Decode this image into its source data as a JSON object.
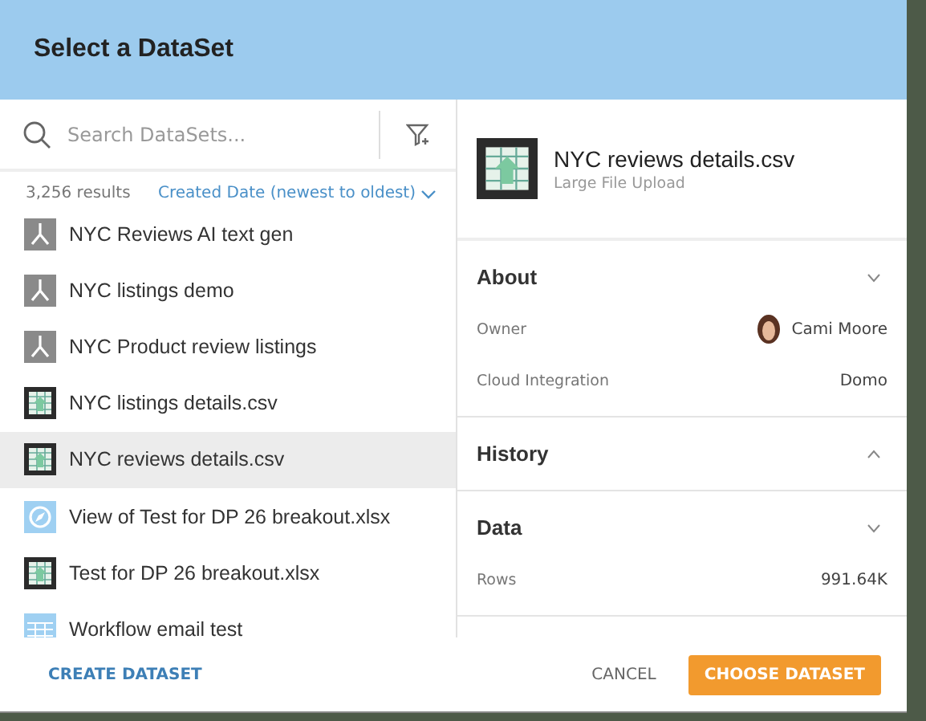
{
  "dialog": {
    "title": "Select a DataSet"
  },
  "search": {
    "placeholder": "Search DataSets..."
  },
  "results": {
    "count": "3,256 results",
    "sort": "Created Date (newest to oldest)"
  },
  "datasets": [
    {
      "name": "NYC Reviews AI text gen",
      "kind": "dataflow",
      "selected": false
    },
    {
      "name": "NYC listings demo",
      "kind": "dataflow",
      "selected": false
    },
    {
      "name": "NYC Product review listings",
      "kind": "dataflow",
      "selected": false
    },
    {
      "name": "NYC listings details.csv",
      "kind": "upload",
      "selected": false
    },
    {
      "name": "NYC reviews details.csv",
      "kind": "upload",
      "selected": true
    },
    {
      "name": "View of Test for DP 26 breakout.xlsx",
      "kind": "view",
      "selected": false
    },
    {
      "name": "Test for DP 26 breakout.xlsx",
      "kind": "upload",
      "selected": false
    },
    {
      "name": "Workflow email test",
      "kind": "table",
      "selected": false
    }
  ],
  "details": {
    "name": "NYC reviews details.csv",
    "source": "Large File Upload",
    "sections": [
      {
        "title": "About",
        "expanded": true,
        "fields": [
          {
            "label": "Owner",
            "value": "Cami Moore",
            "kind": "person"
          },
          {
            "label": "Cloud Integration",
            "value": "Domo",
            "kind": "text"
          }
        ]
      },
      {
        "title": "History",
        "expanded": false
      },
      {
        "title": "Data",
        "expanded": true,
        "fields": [
          {
            "label": "Rows",
            "value": "991.64K",
            "kind": "text"
          }
        ]
      }
    ]
  },
  "footer": {
    "create": "CREATE DATASET",
    "cancel": "CANCEL",
    "choose": "CHOOSE DATASET"
  }
}
